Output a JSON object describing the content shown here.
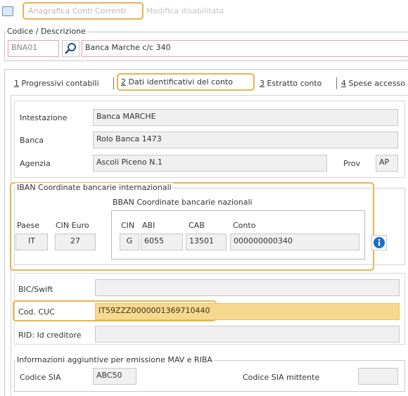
{
  "title_bar": {
    "active_tab": "Anagrafica Conti Correnti",
    "inactive_tab": "Modifica disabilitata"
  },
  "codice": {
    "group_label": "Codice / Descrizione",
    "code": "BNA01",
    "description": "Banca Marche c/c 340"
  },
  "tabs": [
    {
      "key": "1",
      "label": " Progressivi contabili"
    },
    {
      "key": "2",
      "label": " Dati identificativi del conto"
    },
    {
      "key": "3",
      "label": " Estratto conto"
    },
    {
      "key": "4",
      "label": " Spese accesso"
    }
  ],
  "fields": {
    "intestazione_label": "Intestazione",
    "intestazione_value": "Banca MARCHE",
    "banca_label": "Banca",
    "banca_value": "Rolo Banca 1473",
    "agenzia_label": "Agenzia",
    "agenzia_value": "Ascoli Piceno N.1",
    "prov_label": "Prov",
    "prov_value": "AP"
  },
  "iban": {
    "group_label": "IBAN Coordinate bancarie internazionali",
    "bban_label": "BBAN Coordinate bancarie nazionali",
    "paese_label": "Paese",
    "paese_value": "IT",
    "cin_euro_label": "CIN Euro",
    "cin_euro_value": "27",
    "cin_label": "CIN",
    "cin_value": "G",
    "abi_label": "ABI",
    "abi_value": "6055",
    "cab_label": "CAB",
    "cab_value": "13501",
    "conto_label": "Conto",
    "conto_value": "000000000340"
  },
  "other": {
    "bic_label": "BIC/Swift",
    "bic_value": "",
    "cuc_label": "Cod. CUC",
    "cuc_value": "IT59ZZZ0000001369710440",
    "rid_label": "RID: Id creditore",
    "rid_value": ""
  },
  "info_mav": {
    "group_label": "Informazioni aggiuntive per emissione MAV e RIBA",
    "sia_label": "Codice SIA",
    "sia_value": "ABC50",
    "sia_mittente_label": "Codice SIA mittente",
    "sia_mittente_value": ""
  },
  "colors": {
    "highlight": "#e8b450",
    "pink_border": "#e6a0b0",
    "cuc_fill": "#f7d98d",
    "info_icon": "#1a6fc4"
  }
}
